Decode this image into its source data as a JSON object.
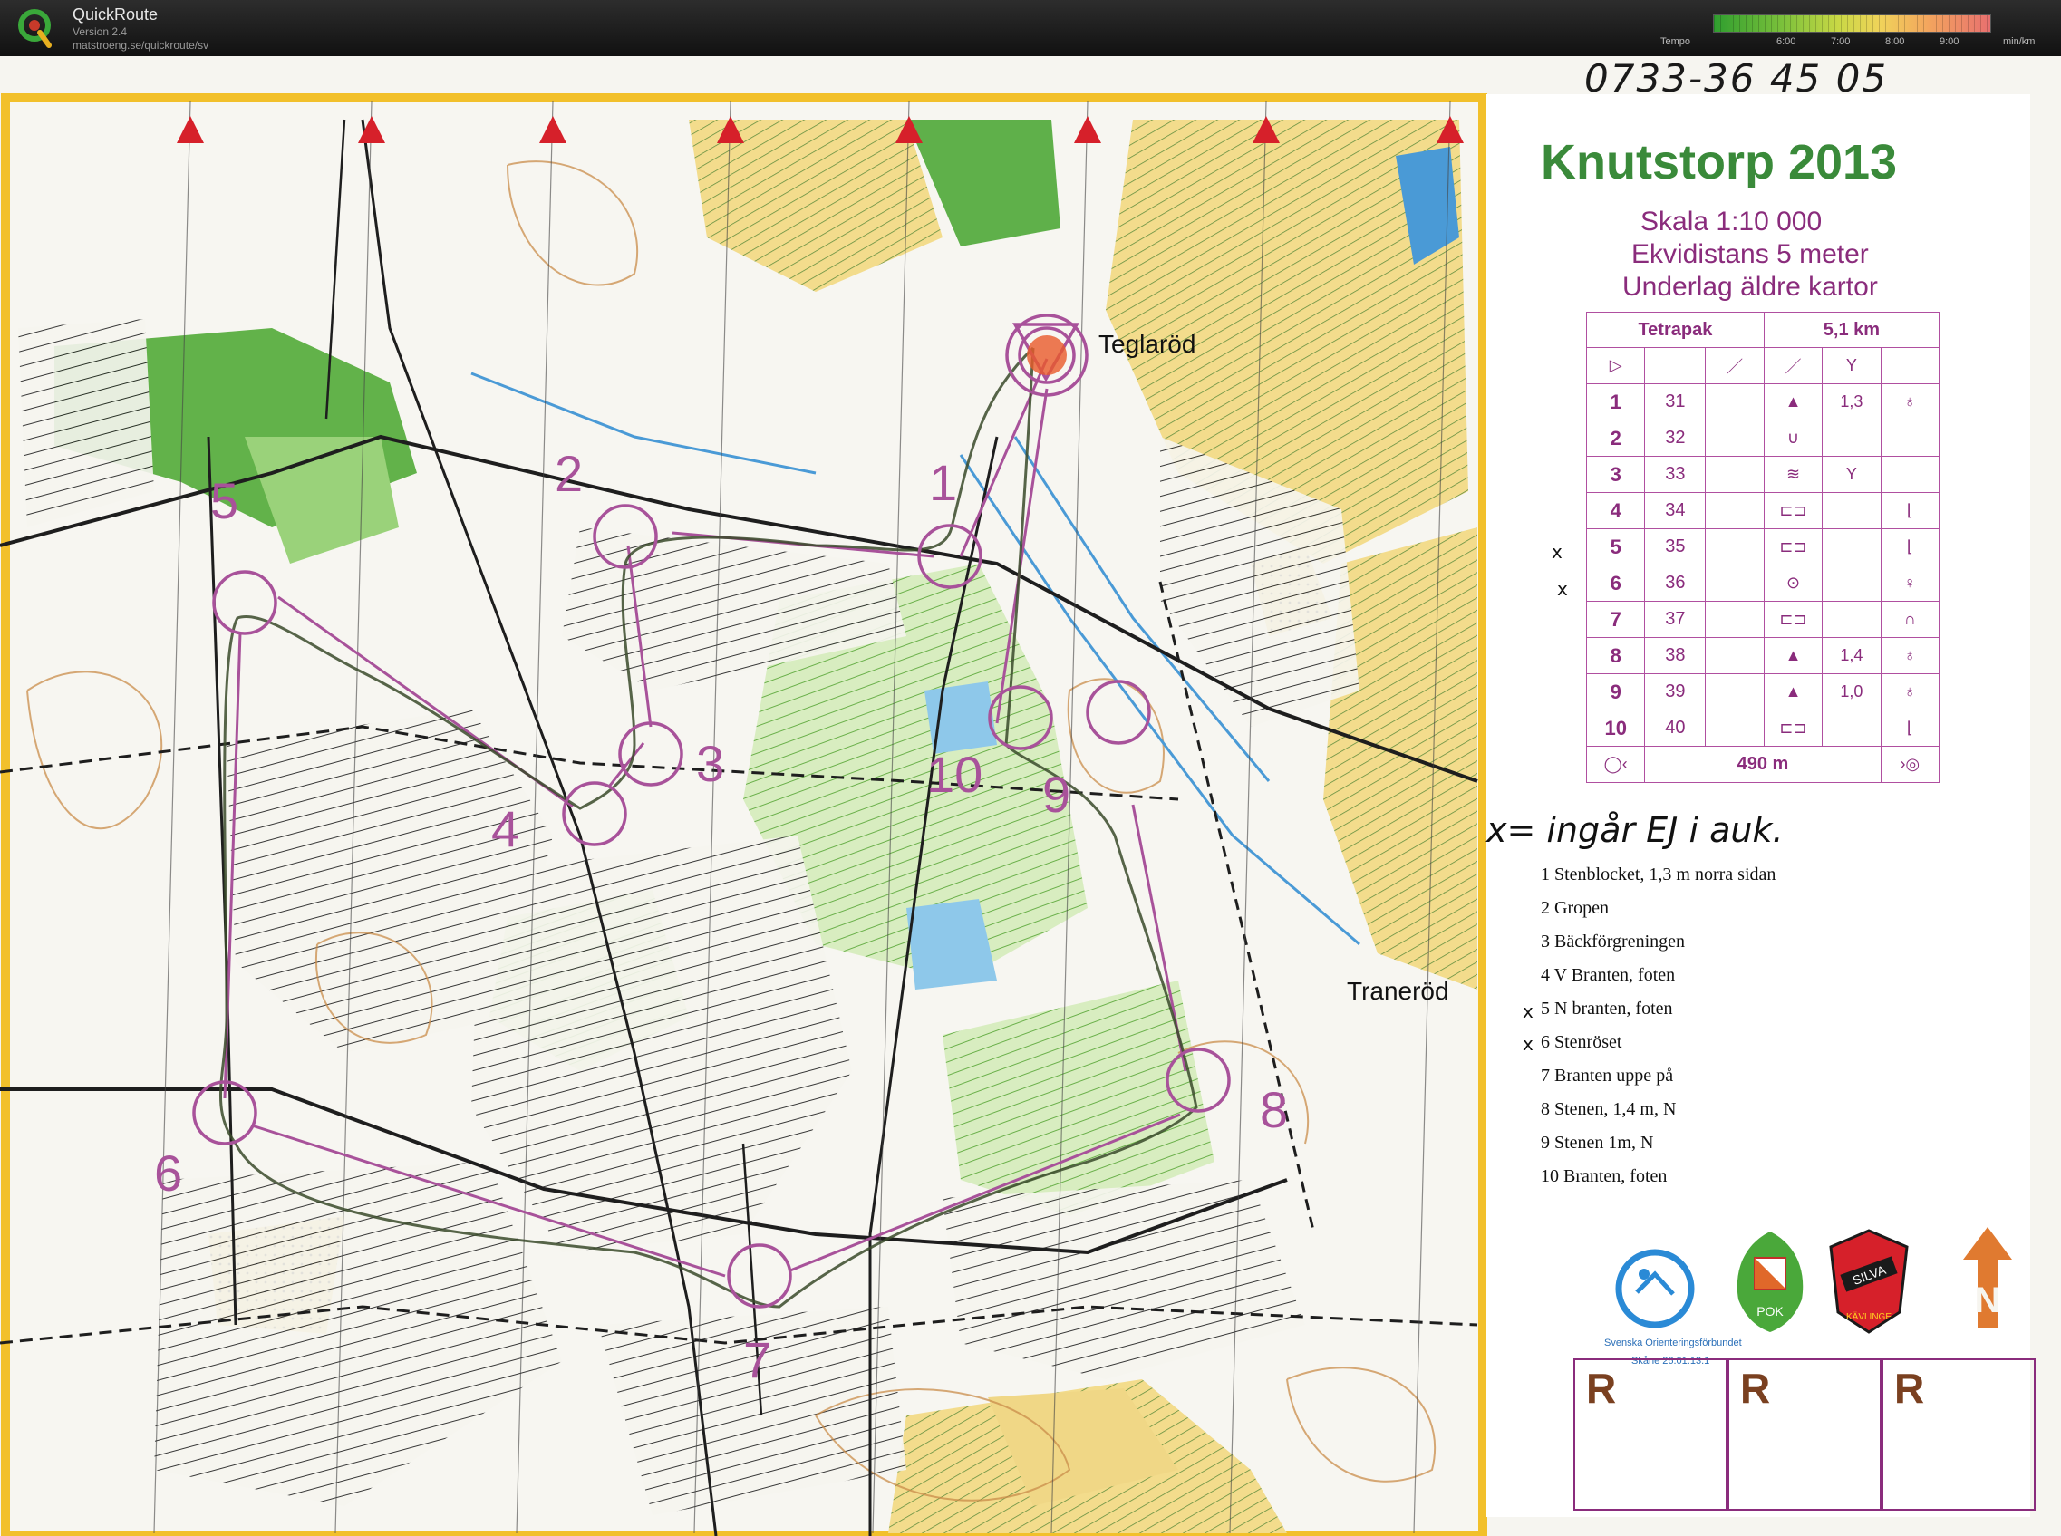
{
  "app": {
    "title": "QuickRoute",
    "version": "Version 2.4",
    "url": "matstroeng.se/quickroute/sv",
    "tempo_label": "Tempo",
    "tempo_ticks": [
      "6:00",
      "7:00",
      "8:00",
      "9:00"
    ],
    "tempo_unit": "min/km"
  },
  "map": {
    "phone_note": "0733-36 45 05",
    "title": "Knutstorp 2013",
    "scale": "Skala 1:10 000",
    "contour": "Ekvidistans 5 meter",
    "base": "Underlag äldre kartor",
    "places": [
      "Teglaröd",
      "Traneröd"
    ],
    "control_numbers": [
      "1",
      "2",
      "3",
      "4",
      "5",
      "6",
      "7",
      "8",
      "9",
      "10"
    ],
    "colors": {
      "course": "#a8529a",
      "forest_green": "#62b24a",
      "open_yellow": "#e8c86a",
      "water_blue": "#6bb3e0",
      "track_red": "#c23b2a",
      "frame_yellow": "#f2c02b"
    }
  },
  "control_table": {
    "course": "Tetrapak",
    "length": "5,1 km",
    "rows": [
      {
        "n": "1",
        "code": "31",
        "feat": "▲",
        "size": "1,3",
        "where": "♁"
      },
      {
        "n": "2",
        "code": "32",
        "feat": "∪",
        "size": "",
        "where": ""
      },
      {
        "n": "3",
        "code": "33",
        "feat": "≋",
        "size": "Y",
        "where": ""
      },
      {
        "n": "4",
        "code": "34",
        "feat": "⊏⊐",
        "size": "",
        "where": "⌊"
      },
      {
        "n": "5",
        "code": "35",
        "feat": "⊏⊐",
        "size": "",
        "where": "⌊"
      },
      {
        "n": "6",
        "code": "36",
        "feat": "⊙",
        "size": "",
        "where": "♀"
      },
      {
        "n": "7",
        "code": "37",
        "feat": "⊏⊐",
        "size": "",
        "where": "∩"
      },
      {
        "n": "8",
        "code": "38",
        "feat": "▲",
        "size": "1,4",
        "where": "♁"
      },
      {
        "n": "9",
        "code": "39",
        "feat": "▲",
        "size": "1,0",
        "where": "♁"
      },
      {
        "n": "10",
        "code": "40",
        "feat": "⊏⊐",
        "size": "",
        "where": "⌊"
      }
    ],
    "finish": "490 m"
  },
  "legend": {
    "note": "x= ingår EJ i auk.",
    "descriptions": [
      "1 Stenblocket, 1,3 m norra sidan",
      "2 Gropen",
      "3 Bäckförgreningen",
      "4 V Branten, foten",
      "5 N branten, foten",
      "6 Stenröset",
      "7 Branten uppe på",
      "8 Stenen, 1,4 m, N",
      "9 Stenen 1m, N",
      "10 Branten, foten"
    ],
    "logo_caption_1": "Svenska Orienteringsförbundet",
    "logo_caption_2": "Skåne 26.01.13.1",
    "club_1": "POK",
    "club_2": "SILVA KÄVLINGE",
    "r_boxes": [
      "R",
      "R",
      "R"
    ]
  }
}
